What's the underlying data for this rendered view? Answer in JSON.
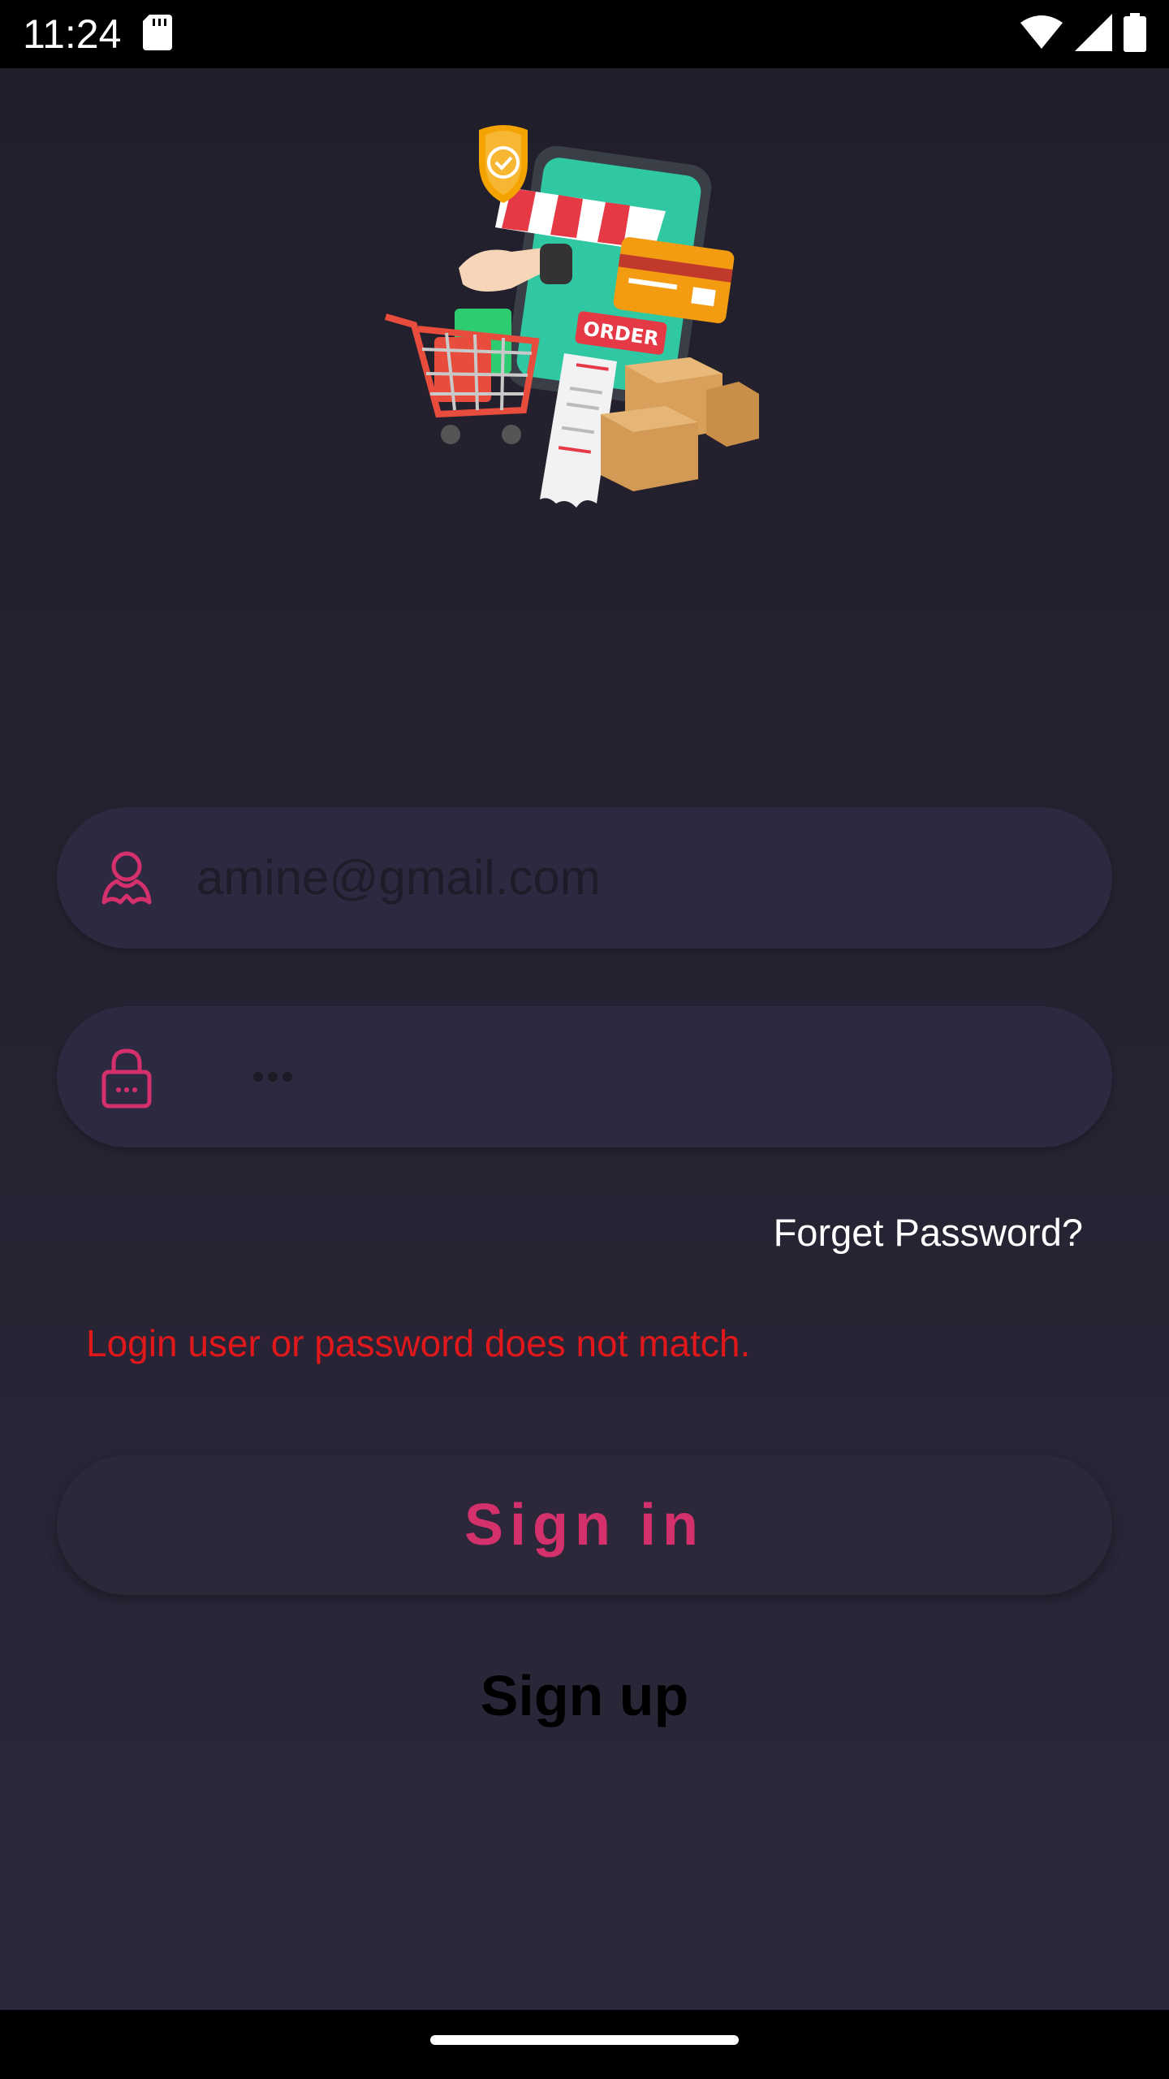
{
  "status_bar": {
    "time": "11:24",
    "icons": [
      "sd-card-icon",
      "wifi-icon",
      "cellular-signal-icon",
      "battery-icon"
    ]
  },
  "hero": {
    "icon": "online-shopping-illustration",
    "order_tag": "ORDER"
  },
  "login_form": {
    "email": {
      "value": "amine@gmail.com",
      "icon": "user-icon"
    },
    "password": {
      "masked_length": 3,
      "icon": "lock-icon"
    },
    "forget_password_label": "Forget Password?",
    "error_message": "Login user or password does not match.",
    "sign_in_label": "Sign in",
    "sign_up_label": "Sign up"
  },
  "colors": {
    "accent": "#d4306b",
    "error": "#e0181c",
    "background": "#252130",
    "field": "#2d2940"
  }
}
